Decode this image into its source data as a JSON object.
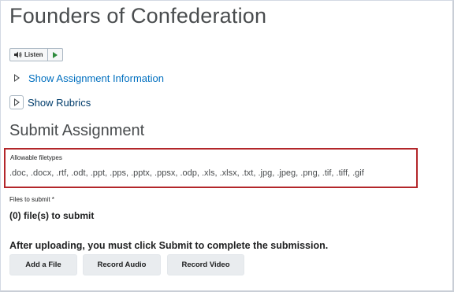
{
  "page": {
    "title": "Founders of Confederation"
  },
  "listen": {
    "label": "Listen"
  },
  "disclosures": {
    "assignment_info": "Show Assignment Information",
    "rubrics": "Show Rubrics"
  },
  "submit": {
    "heading": "Submit Assignment",
    "allowable_label": "Allowable filetypes",
    "allowable_value": ".doc, .docx, .rtf, .odt, .ppt, .pps, .pptx, .ppsx, .odp, .xls, .xlsx, .txt, .jpg, .jpeg, .png, .tif, .tiff, .gif",
    "files_label": "Files to submit *",
    "files_count": "(0) file(s) to submit",
    "after_message": "After uploading, you must click Submit to complete the submission."
  },
  "buttons": {
    "add_file": "Add a File",
    "record_audio": "Record Audio",
    "record_video": "Record Video"
  },
  "colors": {
    "link": "#006fbf",
    "highlight_border": "#b3262a",
    "play_icon": "#2e8b3d"
  }
}
